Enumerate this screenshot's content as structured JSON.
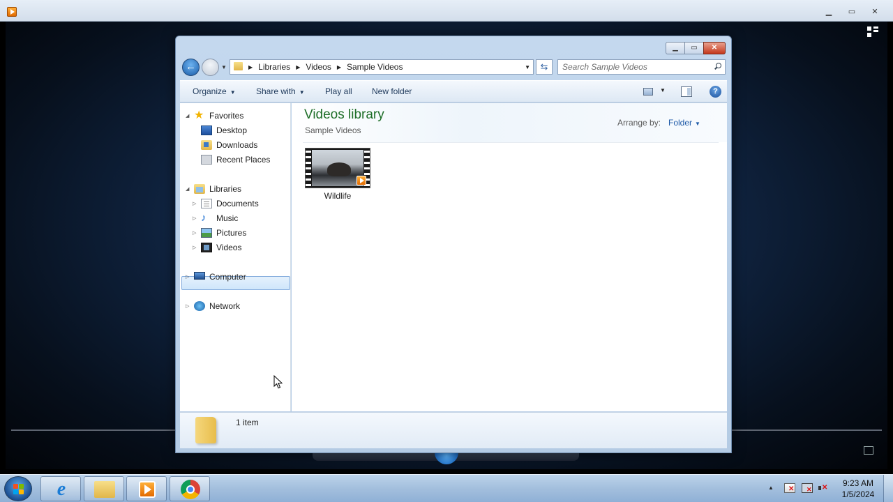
{
  "explorer": {
    "breadcrumbs": [
      "Libraries",
      "Videos",
      "Sample Videos"
    ],
    "search_placeholder": "Search Sample Videos",
    "toolbar": {
      "organize": "Organize",
      "share_with": "Share with",
      "play_all": "Play all",
      "new_folder": "New folder"
    },
    "nav": {
      "favorites": "Favorites",
      "desktop": "Desktop",
      "downloads": "Downloads",
      "recent_places": "Recent Places",
      "libraries": "Libraries",
      "documents": "Documents",
      "music": "Music",
      "pictures": "Pictures",
      "videos": "Videos",
      "computer": "Computer",
      "network": "Network"
    },
    "content": {
      "title": "Videos library",
      "subtitle": "Sample Videos",
      "arrange_by_label": "Arrange by:",
      "arrange_by_value": "Folder",
      "items": [
        {
          "name": "Wildlife",
          "type": "video"
        }
      ]
    },
    "details": {
      "item_count": "1 item"
    }
  },
  "taskbar": {
    "apps": [
      "internet-explorer",
      "windows-explorer",
      "media-player",
      "chrome"
    ],
    "clock": {
      "time": "9:23 AM",
      "date": "1/5/2024"
    }
  },
  "colors": {
    "library_title": "#1e6e28",
    "link_blue": "#1e5aa8",
    "selection_border": "#84acdd"
  }
}
